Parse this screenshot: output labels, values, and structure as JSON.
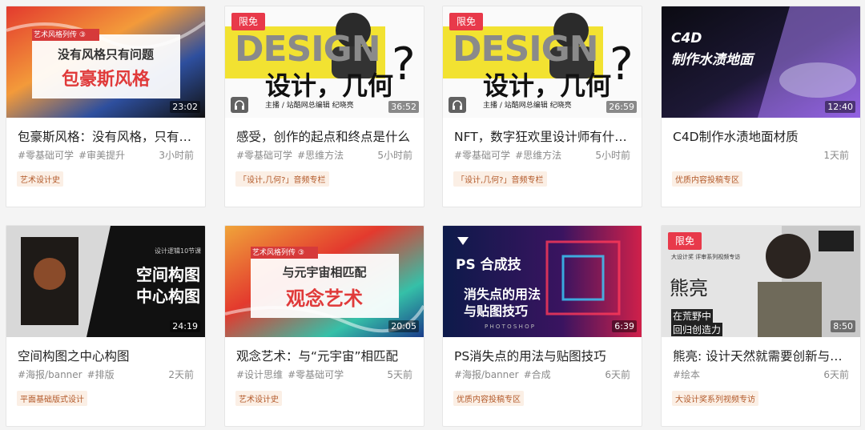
{
  "cards": [
    {
      "title": "包豪斯风格：没有风格，只有问题",
      "tags": [
        "#零基础可学",
        "#审美提升"
      ],
      "time": "3小时前",
      "column": "艺术设计史",
      "duration": "23:02",
      "thumb": {
        "series": "艺术风格列传 ③",
        "line1": "没有风格只有问题",
        "line2": "包豪斯风格"
      }
    },
    {
      "title": "感受，创作的起点和终点是什么",
      "tags": [
        "#零基础可学",
        "#思维方法"
      ],
      "time": "5小时前",
      "column": "「设计,几何?」音频专栏",
      "duration": "36:52",
      "badge": "限免",
      "thumb": {
        "big": "DESIGN",
        "cn": "设计，几何",
        "q": "?",
        "host": "主播 / 站酷网总编辑 纪晓亮"
      }
    },
    {
      "title": "NFT，数字狂欢里设计师有什么机会",
      "tags": [
        "#零基础可学",
        "#思维方法"
      ],
      "time": "5小时前",
      "column": "「设计,几何?」音频专栏",
      "duration": "26:59",
      "badge": "限免",
      "thumb": {
        "big": "DESIGN",
        "cn": "设计，几何",
        "q": "?",
        "host": "主播 / 站酷网总编辑 纪晓亮"
      }
    },
    {
      "title": "C4D制作水渍地面材质",
      "tags": [],
      "time": "1天前",
      "column": "优质内容投稿专区",
      "duration": "12:40",
      "thumb": {
        "line1": "C4D",
        "line2": "制作水渍地面"
      }
    },
    {
      "title": "空间构图之中心构图",
      "tags": [
        "#海报/banner",
        "#排版"
      ],
      "time": "2天前",
      "column": "平面基础版式设计",
      "duration": "24:19",
      "thumb": {
        "line1": "空间构图",
        "line2": "中心构图",
        "small": "设计逻辑10节课"
      }
    },
    {
      "title": "观念艺术：与“元宇宙”相匹配",
      "tags": [
        "#设计思维",
        "#零基础可学"
      ],
      "time": "5天前",
      "column": "艺术设计史",
      "duration": "20:05",
      "thumb": {
        "series": "艺术风格列传 ③",
        "line1": "与元宇宙相匹配",
        "line2": "观念艺术"
      }
    },
    {
      "title": "PS消失点的用法与贴图技巧",
      "tags": [
        "#海报/banner",
        "#合成"
      ],
      "time": "6天前",
      "column": "优质内容投稿专区",
      "duration": "6:39",
      "thumb": {
        "line1": "PS 合成技",
        "line2": "消失点的用法",
        "line3": "与贴图技巧",
        "small": "P H O T O S H O P"
      }
    },
    {
      "title": "熊亮: 设计天然就需要创新与表达",
      "tags": [
        "#绘本"
      ],
      "time": "6天前",
      "column": "大设计奖系列视频专访",
      "duration": "8:50",
      "badge": "限免",
      "thumb": {
        "name": "熊亮",
        "quote1": "在荒野中",
        "quote2": "回归创造力",
        "label": "大设计奖 评审系列视频专访"
      }
    }
  ],
  "icons": {
    "headphone": "headphone-icon"
  },
  "colors": {
    "badge": "#e8394a",
    "accent_orange": "#b35a2a",
    "tag_bg": "#fbefe5"
  }
}
